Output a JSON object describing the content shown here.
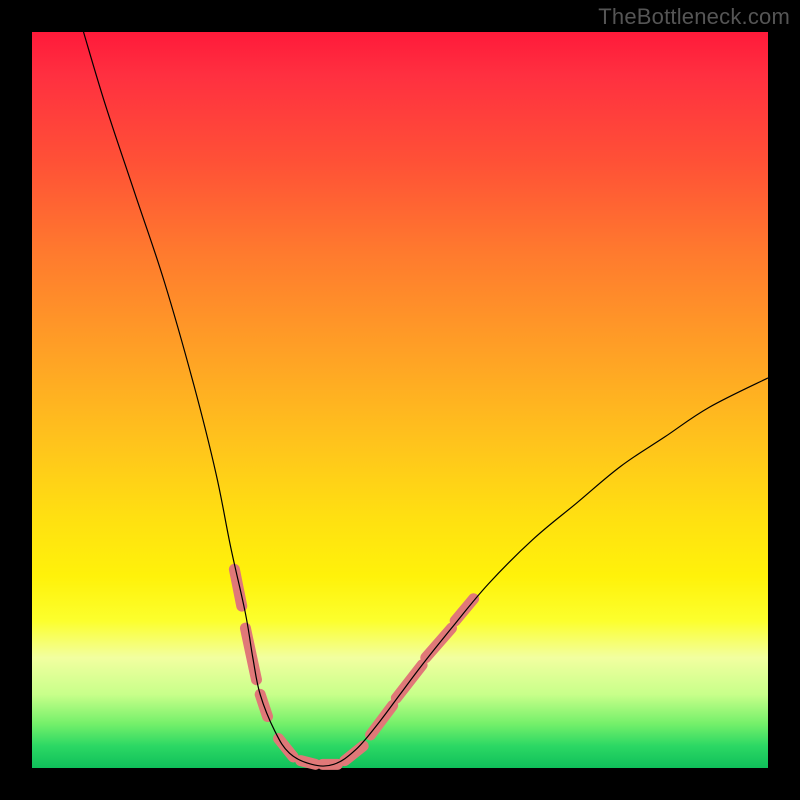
{
  "watermark": "TheBottleneck.com",
  "chart_data": {
    "type": "line",
    "title": "",
    "xlabel": "",
    "ylabel": "",
    "xlim": [
      0,
      100
    ],
    "ylim": [
      0,
      100
    ],
    "grid": false,
    "curves": [
      {
        "name": "main-curve",
        "color": "#000000",
        "width": 1.2,
        "points": [
          {
            "x": 7,
            "y": 100
          },
          {
            "x": 10,
            "y": 90
          },
          {
            "x": 14,
            "y": 78
          },
          {
            "x": 18,
            "y": 66
          },
          {
            "x": 22,
            "y": 52
          },
          {
            "x": 25,
            "y": 40
          },
          {
            "x": 27,
            "y": 30
          },
          {
            "x": 29,
            "y": 21
          },
          {
            "x": 30,
            "y": 15
          },
          {
            "x": 31,
            "y": 10
          },
          {
            "x": 33,
            "y": 5
          },
          {
            "x": 35,
            "y": 2
          },
          {
            "x": 38,
            "y": 0.5
          },
          {
            "x": 41,
            "y": 0.5
          },
          {
            "x": 44,
            "y": 2.5
          },
          {
            "x": 47,
            "y": 6
          },
          {
            "x": 50,
            "y": 10
          },
          {
            "x": 53,
            "y": 14
          },
          {
            "x": 57,
            "y": 19
          },
          {
            "x": 62,
            "y": 25
          },
          {
            "x": 68,
            "y": 31
          },
          {
            "x": 74,
            "y": 36
          },
          {
            "x": 80,
            "y": 41
          },
          {
            "x": 86,
            "y": 45
          },
          {
            "x": 92,
            "y": 49
          },
          {
            "x": 100,
            "y": 53
          }
        ]
      }
    ],
    "markers": [
      {
        "name": "highlighted-segments",
        "color": "#e07878",
        "width": 11,
        "segments": [
          [
            {
              "x": 27.5,
              "y": 27
            },
            {
              "x": 28.5,
              "y": 22
            }
          ],
          [
            {
              "x": 29.0,
              "y": 19
            },
            {
              "x": 30.5,
              "y": 12
            }
          ],
          [
            {
              "x": 31.0,
              "y": 10
            },
            {
              "x": 32.0,
              "y": 7
            }
          ],
          [
            {
              "x": 33.5,
              "y": 4
            },
            {
              "x": 35.5,
              "y": 1.5
            }
          ],
          [
            {
              "x": 36.5,
              "y": 1
            },
            {
              "x": 38.5,
              "y": 0.5
            }
          ],
          [
            {
              "x": 39.5,
              "y": 0.5
            },
            {
              "x": 41.5,
              "y": 0.5
            }
          ],
          [
            {
              "x": 42.5,
              "y": 1
            },
            {
              "x": 45.0,
              "y": 3
            }
          ],
          [
            {
              "x": 46.0,
              "y": 4.5
            },
            {
              "x": 49.0,
              "y": 8.5
            }
          ],
          [
            {
              "x": 49.5,
              "y": 9.5
            },
            {
              "x": 53.0,
              "y": 14
            }
          ],
          [
            {
              "x": 53.5,
              "y": 15
            },
            {
              "x": 57.0,
              "y": 19
            }
          ],
          [
            {
              "x": 57.5,
              "y": 20
            },
            {
              "x": 60.0,
              "y": 23
            }
          ]
        ]
      }
    ]
  }
}
